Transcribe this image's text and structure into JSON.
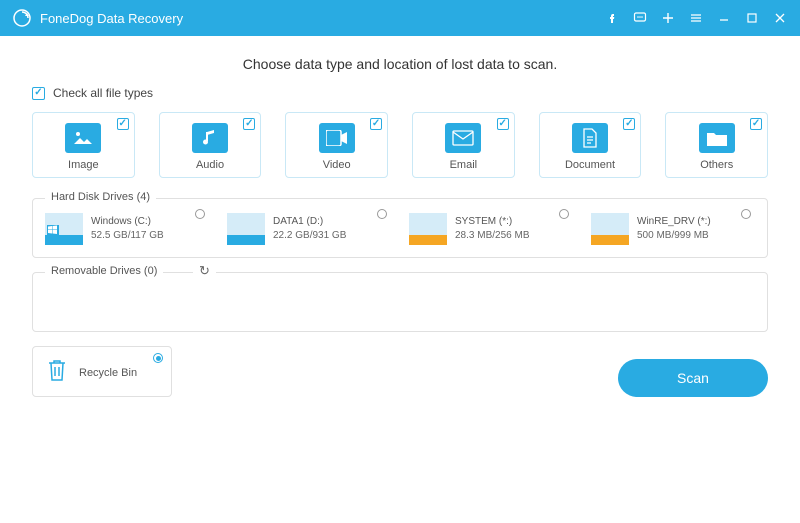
{
  "titlebar": {
    "app_name": "FoneDog Data Recovery"
  },
  "heading": "Choose data type and location of lost data to scan.",
  "check_all_label": "Check all file types",
  "filetypes": [
    {
      "label": "Image",
      "icon": "image-icon",
      "checked": true
    },
    {
      "label": "Audio",
      "icon": "audio-icon",
      "checked": true
    },
    {
      "label": "Video",
      "icon": "video-icon",
      "checked": true
    },
    {
      "label": "Email",
      "icon": "email-icon",
      "checked": true
    },
    {
      "label": "Document",
      "icon": "document-icon",
      "checked": true
    },
    {
      "label": "Others",
      "icon": "others-icon",
      "checked": true
    }
  ],
  "hdd_section_title": "Hard Disk Drives (4)",
  "hdd": [
    {
      "name": "Windows (C:)",
      "size": "52.5 GB/117 GB",
      "color": "#29abe2",
      "win": true
    },
    {
      "name": "DATA1 (D:)",
      "size": "22.2 GB/931 GB",
      "color": "#29abe2",
      "win": false
    },
    {
      "name": "SYSTEM (*:)",
      "size": "28.3 MB/256 MB",
      "color": "#f5a623",
      "win": false
    },
    {
      "name": "WinRE_DRV (*:)",
      "size": "500 MB/999 MB",
      "color": "#f5a623",
      "win": false
    }
  ],
  "removable_section_title": "Removable Drives (0)",
  "recycle_label": "Recycle Bin",
  "scan_label": "Scan"
}
